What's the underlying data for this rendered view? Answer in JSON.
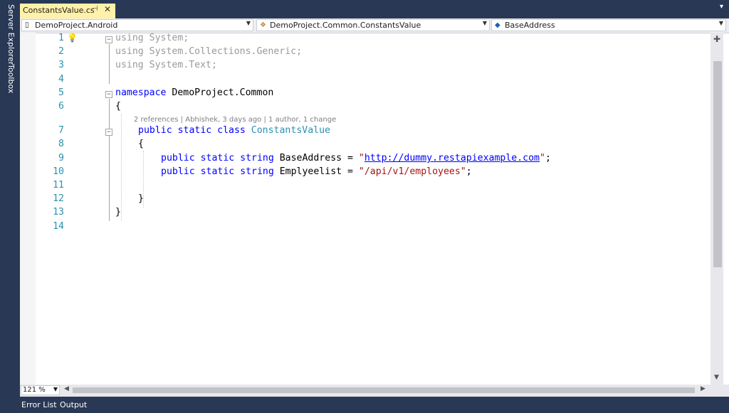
{
  "side_tabs": [
    "Server Explorer",
    "Toolbox"
  ],
  "document_tab": {
    "title": "ConstantsValue.cs",
    "pin_icon": "pin-icon",
    "close_icon": "close-icon"
  },
  "navigation_bar": {
    "project": "DemoProject.Android",
    "type": "DemoProject.Common.ConstantsValue",
    "member": "BaseAddress"
  },
  "code": {
    "line_numbers": [
      "1",
      "2",
      "3",
      "4",
      "5",
      "6",
      "7",
      "8",
      "9",
      "10",
      "11",
      "12",
      "13",
      "14"
    ],
    "using1_kw": "using",
    "using1_ns": " System;",
    "using2_kw": "using",
    "using2_ns": " System.Collections.Generic;",
    "using3_kw": "using",
    "using3_ns": " System.Text;",
    "ns_kw": "namespace",
    "ns_name": " DemoProject.Common",
    "open_brace": "{",
    "codelens": "2 references | Abhishek, 3 days ago | 1 author, 1 change",
    "class_kw": "public static class ",
    "class_name": "ConstantsValue",
    "class_open": "{",
    "l9_kw": "public static string ",
    "l9_name": "BaseAddress = ",
    "l9_q1": "\"",
    "l9_url": "http://dummy.restapiexample.com",
    "l9_q2": "\"",
    "l9_end": ";",
    "l10_kw": "public static string ",
    "l10_name": "Emplyeelist = ",
    "l10_str": "\"/api/v1/employees\"",
    "l10_end": ";",
    "class_close": "}",
    "ns_close": "}"
  },
  "zoom_level": "121 %",
  "bottom_tabs": [
    "Error List",
    "Output"
  ],
  "colors": {
    "background": "#293955",
    "active_tab": "#fff1a8",
    "keyword": "#0000ff",
    "type": "#2b91af",
    "string": "#a31515"
  }
}
